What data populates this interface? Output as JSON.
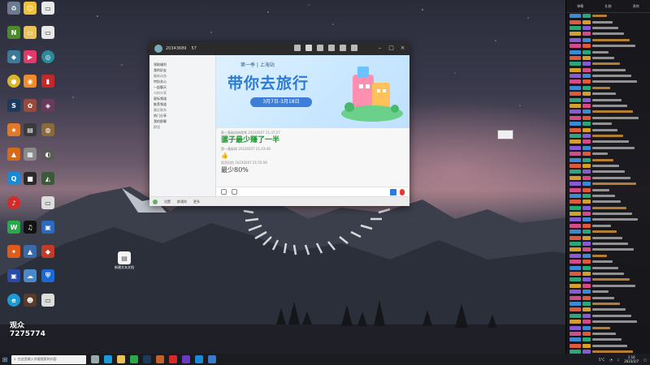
{
  "chat_window": {
    "title_id": "20343689",
    "title_count": "57",
    "banner": {
      "subtitle": "第一季 | 上海站",
      "headline": "带你去旅行",
      "dates": "3月7日-3月18日"
    },
    "left_groups": [
      {
        "label": "领取福利",
        "selected": false
      },
      {
        "label": "我的好友",
        "selected": false
      },
      {
        "label": "最新动态",
        "selected": false
      },
      {
        "label": "特别关心",
        "selected": false
      },
      {
        "label": "一起聊天",
        "selected": false
      },
      {
        "label": "与你分享",
        "selected": true
      },
      {
        "label": "星标频道",
        "selected": false
      },
      {
        "label": "推荐频道",
        "selected": false
      },
      {
        "label": "最近联系",
        "selected": false
      },
      {
        "label": "热门分享",
        "selected": false
      },
      {
        "label": "我的群聊",
        "selected": false
      },
      {
        "label": "群组",
        "selected": false
      }
    ],
    "messages": [
      {
        "meta": "胖三基础网络视频 20230207 21:37:27",
        "text": "骡子最少赚了一半",
        "style": "green"
      },
      {
        "meta": "第一基础网 20230207 21:43:46",
        "text": "👍",
        "style": "thumb"
      },
      {
        "meta": "投资风险 20230207 21:55:06",
        "text": "最少80%",
        "style": "plain"
      }
    ],
    "bottom_labels": [
      "设置",
      "群通知",
      "更多"
    ]
  },
  "right_panel": {
    "tabs": [
      "弹幕",
      "礼物",
      "贵宾"
    ],
    "rows": 58
  },
  "taskbar": {
    "search_placeholder": "在这里输入你要搜索的内容",
    "temp": "5°C",
    "time": "1:16",
    "date": "2023/2/7"
  },
  "overlay": {
    "viewer_label": "观众",
    "viewer_count": "7275774"
  },
  "desktop_item": {
    "label": "新建文本文档"
  },
  "colors": {
    "accent": "#2c7bd6",
    "green_text": "#1a9b2e",
    "panel_bg": "#16161a"
  }
}
